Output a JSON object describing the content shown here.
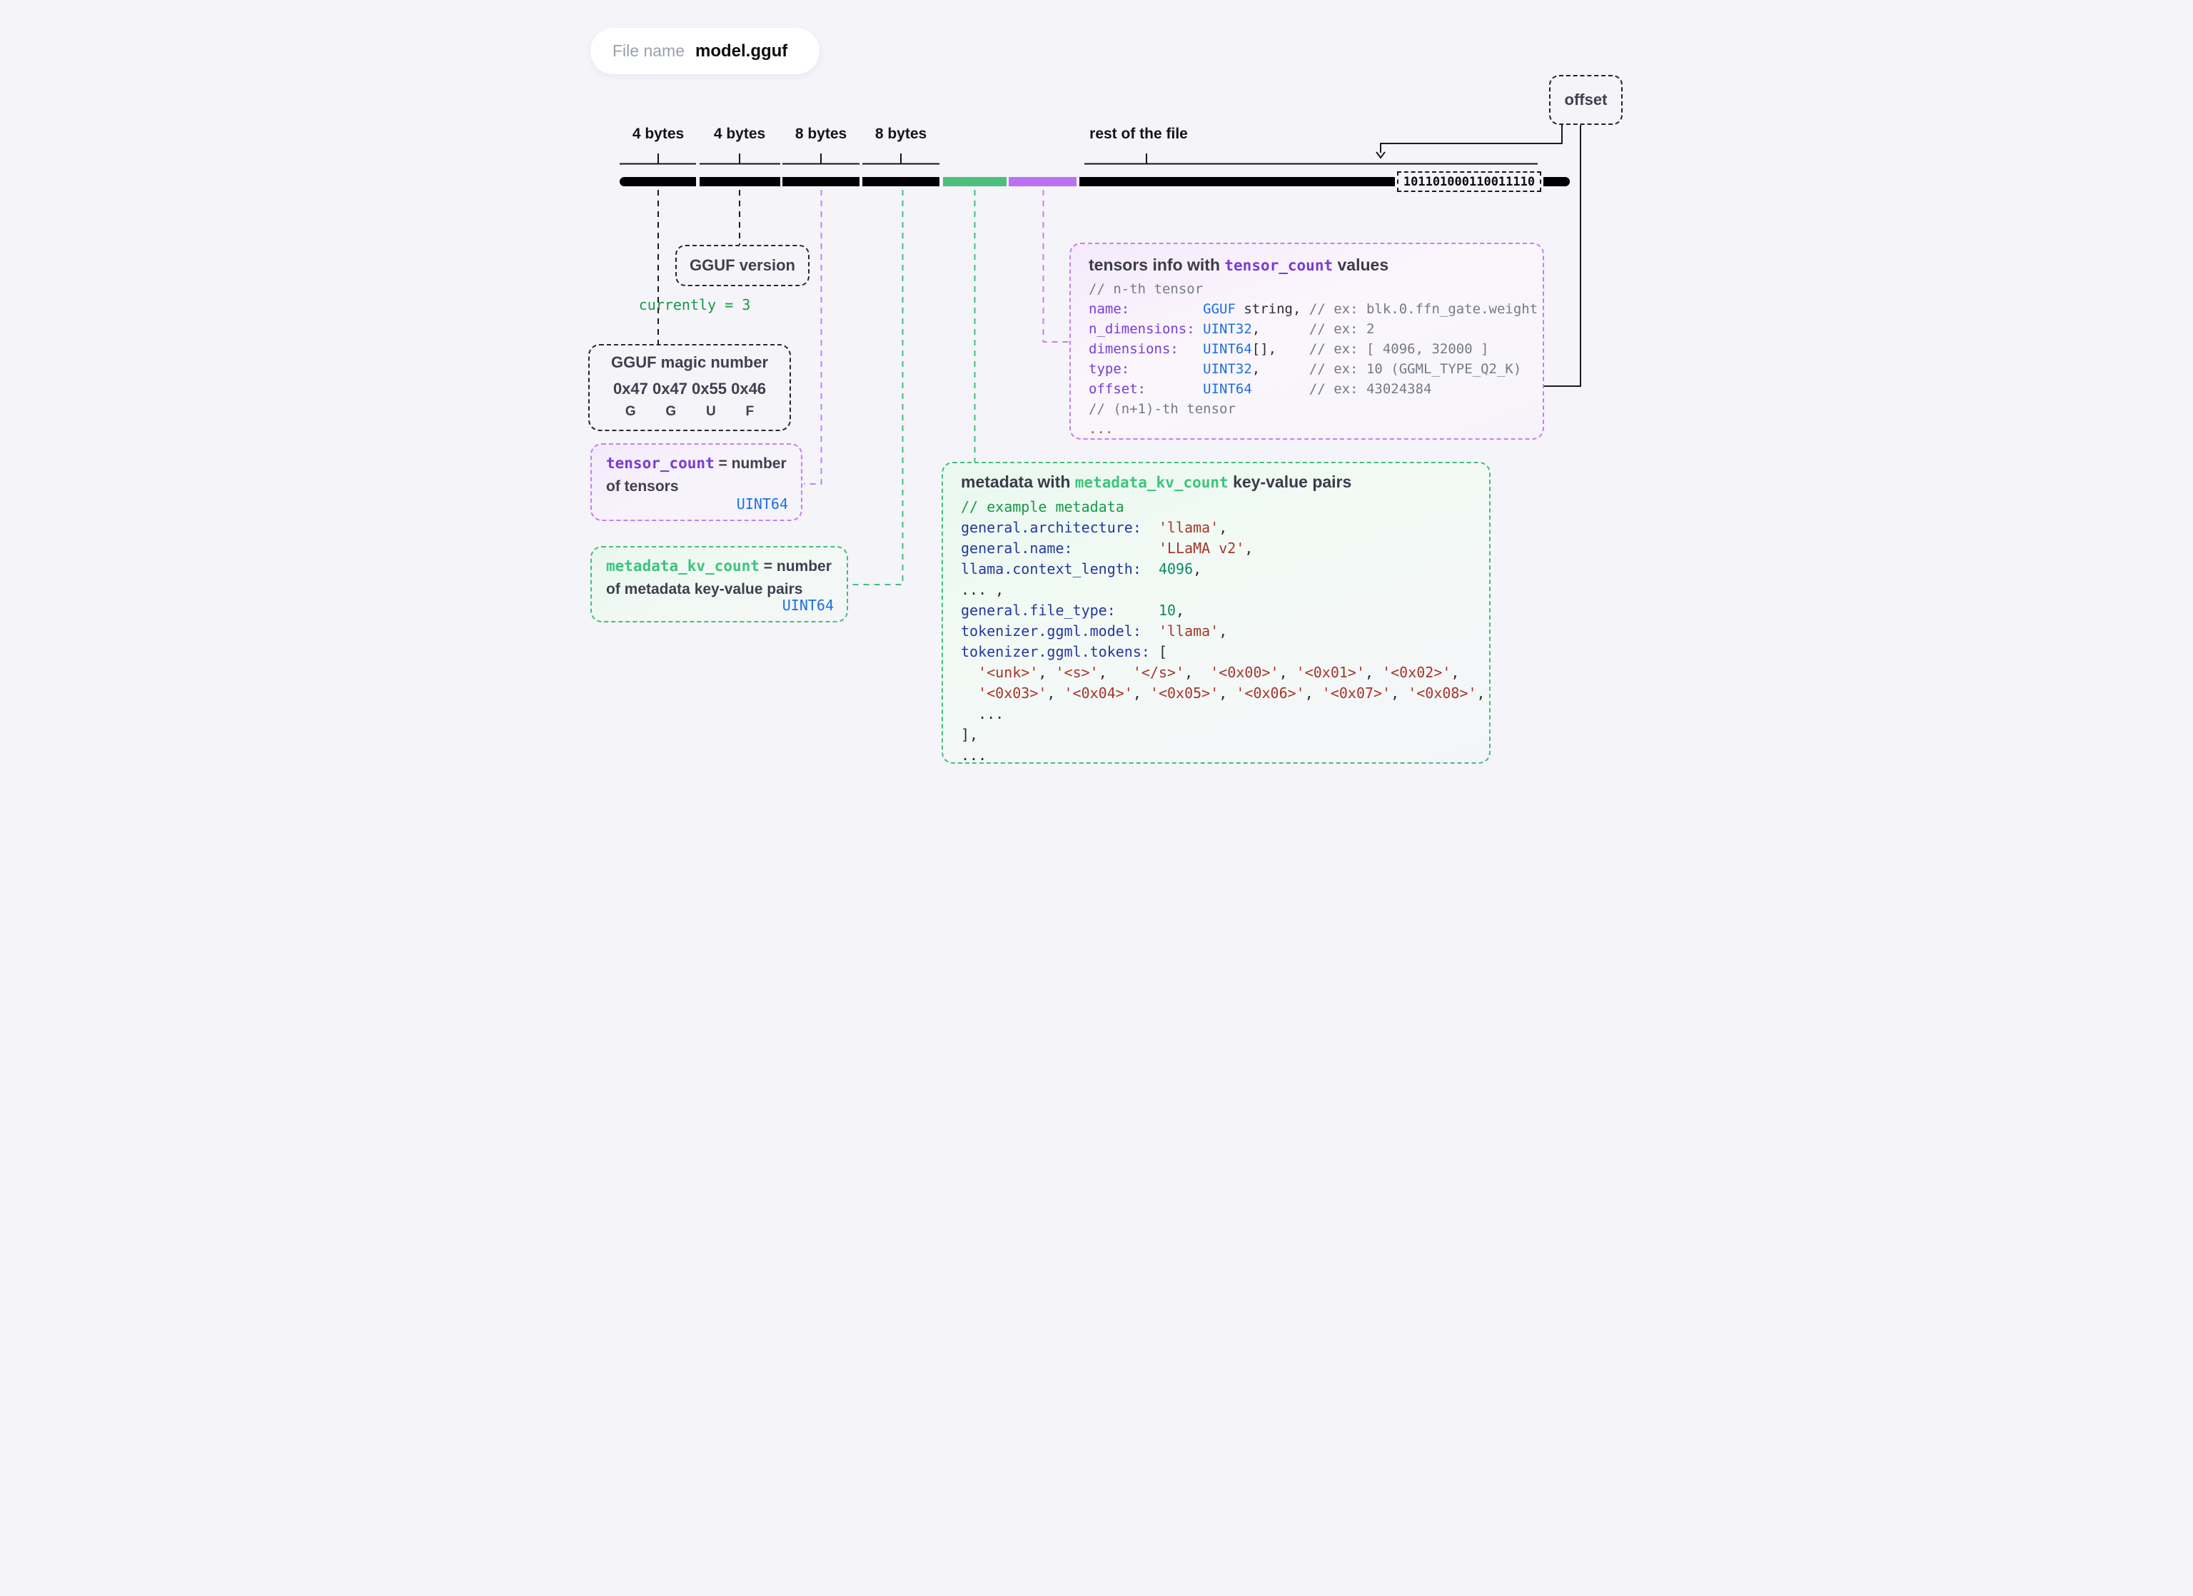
{
  "file_pill": {
    "label": "File name",
    "value": "model.gguf"
  },
  "offset_box": {
    "label": "offset"
  },
  "bar": {
    "byte_labels": [
      "4 bytes",
      "4 bytes",
      "8 bytes",
      "8 bytes"
    ],
    "rest_label": "rest of the file",
    "binary_value": "101101000110011110",
    "segment_colors": {
      "header": "#000000",
      "metadata": "#4cbf7d",
      "tensors_info": "#bb70f2",
      "rest": "#000000"
    }
  },
  "version_box": {
    "title": "GGUF version",
    "note": "currently = 3"
  },
  "magic_box": {
    "title": "GGUF magic number",
    "hex": "0x47 0x47 0x55 0x46",
    "letters": [
      "G",
      "G",
      "U",
      "F"
    ]
  },
  "tensor_count_box": {
    "code": "tensor_count",
    "eq": " = number",
    "line2": "of tensors",
    "type": "UINT64"
  },
  "metadata_kv_box": {
    "code": "metadata_kv_count",
    "eq": " = number",
    "line2": "of metadata key-value pairs",
    "type": "UINT64"
  },
  "tensors_box": {
    "title_pre": "tensors info with ",
    "title_code": "tensor_count",
    "title_post": " values",
    "lines": [
      [
        {
          "c": "g",
          "t": "// n-th tensor"
        }
      ],
      [
        {
          "c": "p",
          "t": "name:         "
        },
        {
          "c": "b",
          "t": "GGUF"
        },
        {
          "c": "d",
          "t": " string, "
        },
        {
          "c": "g",
          "t": "// ex: blk.0.ffn_gate.weight"
        }
      ],
      [
        {
          "c": "p",
          "t": "n_dimensions: "
        },
        {
          "c": "b",
          "t": "UINT32"
        },
        {
          "c": "d",
          "t": ",      "
        },
        {
          "c": "g",
          "t": "// ex: 2"
        }
      ],
      [
        {
          "c": "p",
          "t": "dimensions:   "
        },
        {
          "c": "b",
          "t": "UINT64"
        },
        {
          "c": "d",
          "t": "[],    "
        },
        {
          "c": "g",
          "t": "// ex: [ 4096, 32000 ]"
        }
      ],
      [
        {
          "c": "p",
          "t": "type:         "
        },
        {
          "c": "b",
          "t": "UINT32"
        },
        {
          "c": "d",
          "t": ",      "
        },
        {
          "c": "g",
          "t": "// ex: 10 (GGML_TYPE_Q2_K)"
        }
      ],
      [
        {
          "c": "p",
          "t": "offset:       "
        },
        {
          "c": "b",
          "t": "UINT64"
        },
        {
          "c": "d",
          "t": "       "
        },
        {
          "c": "g",
          "t": "// ex: 43024384"
        }
      ],
      [
        {
          "c": "g",
          "t": "// (n+1)-th tensor"
        }
      ],
      [
        {
          "c": "r",
          "t": "..."
        }
      ]
    ]
  },
  "metadata_box": {
    "title_pre": "metadata with ",
    "title_code": "metadata_kv_count",
    "title_post": " key-value pairs",
    "lines": [
      [
        {
          "c": "cg",
          "t": "// example metadata"
        }
      ],
      [
        {
          "c": "k",
          "t": "general.architecture:  "
        },
        {
          "c": "s",
          "t": "'llama'"
        },
        {
          "c": "d",
          "t": ","
        }
      ],
      [
        {
          "c": "k",
          "t": "general.name:          "
        },
        {
          "c": "s",
          "t": "'LLaMA v2'"
        },
        {
          "c": "d",
          "t": ","
        }
      ],
      [
        {
          "c": "k",
          "t": "llama.context_length:  "
        },
        {
          "c": "n",
          "t": "4096"
        },
        {
          "c": "d",
          "t": ","
        }
      ],
      [
        {
          "c": "d",
          "t": "... ,"
        }
      ],
      [
        {
          "c": "k",
          "t": "general.file_type:     "
        },
        {
          "c": "n",
          "t": "10"
        },
        {
          "c": "d",
          "t": ","
        }
      ],
      [
        {
          "c": "k",
          "t": "tokenizer.ggml.model:  "
        },
        {
          "c": "s",
          "t": "'llama'"
        },
        {
          "c": "d",
          "t": ","
        }
      ],
      [
        {
          "c": "k",
          "t": "tokenizer.ggml.tokens: "
        },
        {
          "c": "d",
          "t": "["
        }
      ],
      [
        {
          "c": "d",
          "t": "  "
        },
        {
          "c": "s",
          "t": "'<unk>'"
        },
        {
          "c": "d",
          "t": ", "
        },
        {
          "c": "s",
          "t": "'<s>'"
        },
        {
          "c": "d",
          "t": ",   "
        },
        {
          "c": "s",
          "t": "'</s>'"
        },
        {
          "c": "d",
          "t": ",  "
        },
        {
          "c": "s",
          "t": "'<0x00>'"
        },
        {
          "c": "d",
          "t": ", "
        },
        {
          "c": "s",
          "t": "'<0x01>'"
        },
        {
          "c": "d",
          "t": ", "
        },
        {
          "c": "s",
          "t": "'<0x02>'"
        },
        {
          "c": "d",
          "t": ","
        }
      ],
      [
        {
          "c": "d",
          "t": "  "
        },
        {
          "c": "s",
          "t": "'<0x03>'"
        },
        {
          "c": "d",
          "t": ", "
        },
        {
          "c": "s",
          "t": "'<0x04>'"
        },
        {
          "c": "d",
          "t": ", "
        },
        {
          "c": "s",
          "t": "'<0x05>'"
        },
        {
          "c": "d",
          "t": ", "
        },
        {
          "c": "s",
          "t": "'<0x06>'"
        },
        {
          "c": "d",
          "t": ", "
        },
        {
          "c": "s",
          "t": "'<0x07>'"
        },
        {
          "c": "d",
          "t": ", "
        },
        {
          "c": "s",
          "t": "'<0x08>'"
        },
        {
          "c": "d",
          "t": ","
        }
      ],
      [
        {
          "c": "d",
          "t": "  ..."
        }
      ],
      [
        {
          "c": "d",
          "t": "],"
        }
      ],
      [
        {
          "c": "d",
          "t": "..."
        }
      ]
    ]
  },
  "colors": {
    "background": "#f4f4f9",
    "bar_black": "#000000",
    "bar_green": "#4cbf7d",
    "bar_purple": "#bb70f2",
    "purple_accent": "#7a3bd6",
    "green_accent": "#3ec47d",
    "blue_type": "#1e6fe0",
    "navy_key": "#24389c",
    "red_string": "#a5352c",
    "teal_number": "#0c8a63",
    "comment_gray": "#757b85",
    "comment_green": "#169a47"
  }
}
